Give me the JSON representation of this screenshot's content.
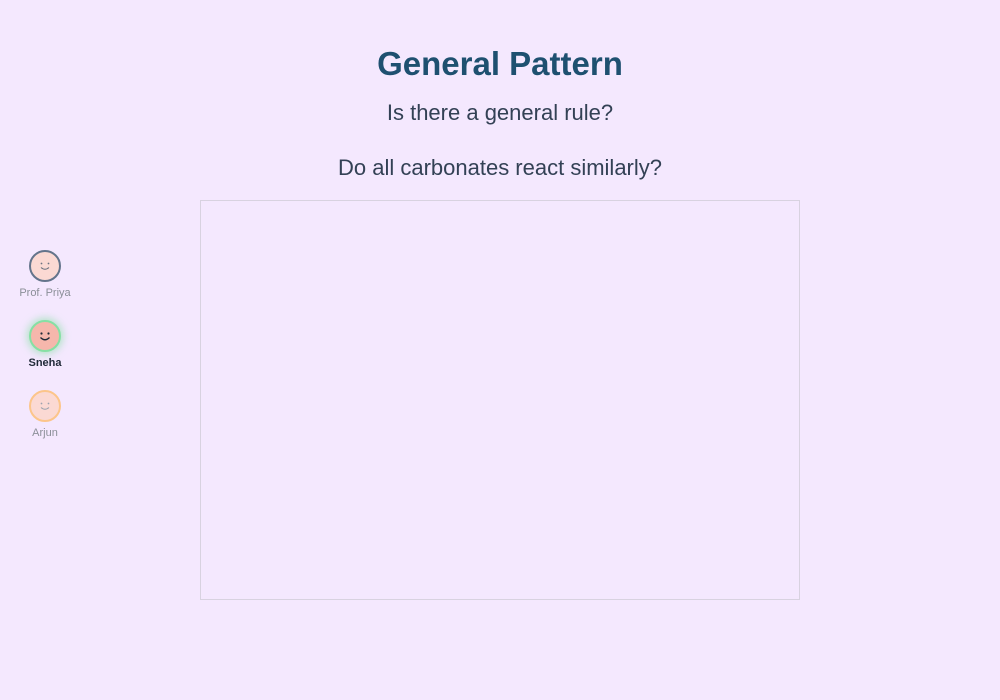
{
  "slide": {
    "title": "General Pattern",
    "subtitle": "Is there a general rule?",
    "question": "Do all carbonates react similarly?"
  },
  "participants": [
    {
      "name": "Prof. Priya",
      "ring_color": "#64748b",
      "active": false
    },
    {
      "name": "Sneha",
      "ring_color": "#86e0a4",
      "active": true
    },
    {
      "name": "Arjun",
      "ring_color": "#fcc58a",
      "active": false
    }
  ],
  "colors": {
    "background": "#f4e8fe",
    "title": "#1e5070",
    "text": "#334155"
  },
  "icons": {
    "avatar": "smiley-face-icon"
  }
}
